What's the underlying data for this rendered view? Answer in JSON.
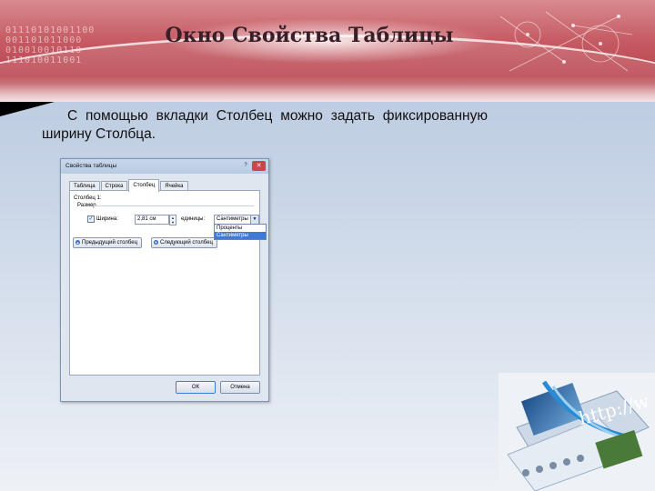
{
  "slide": {
    "title": "Окно Свойства Таблицы",
    "binary_text": "01110101001100\n001101011000\n010010010110\n111010011001",
    "body_text": "С помощью вкладки Столбец можно задать фиксированную ширину Столбца.",
    "deco_url_text": "http://w"
  },
  "dialog": {
    "title": "Свойства таблицы",
    "help_label": "?",
    "close_label": "✕",
    "tabs": [
      {
        "label": "Таблица",
        "active": false
      },
      {
        "label": "Строка",
        "active": false
      },
      {
        "label": "Столбец",
        "active": true
      },
      {
        "label": "Ячейка",
        "active": false
      }
    ],
    "column_label": "Столбец 1:",
    "size_group_label": "Размер",
    "width_checkbox_checked": true,
    "width_label": "Ширина:",
    "width_value": "2,81 см",
    "units_label": "единицы:",
    "units_value": "Сантиметры",
    "units_options": [
      "Проценты",
      "Сантиметры"
    ],
    "units_selected": "Сантиметры",
    "prev_column_label": "Предыдущий столбец",
    "next_column_label": "Следующий столбец",
    "ok_label": "ОК",
    "cancel_label": "Отмена"
  },
  "colors": {
    "banner": "#c65b63",
    "title_text": "#3a1f28",
    "dialog_bg": "#dfe6f0",
    "selection": "#3d7bd7"
  }
}
